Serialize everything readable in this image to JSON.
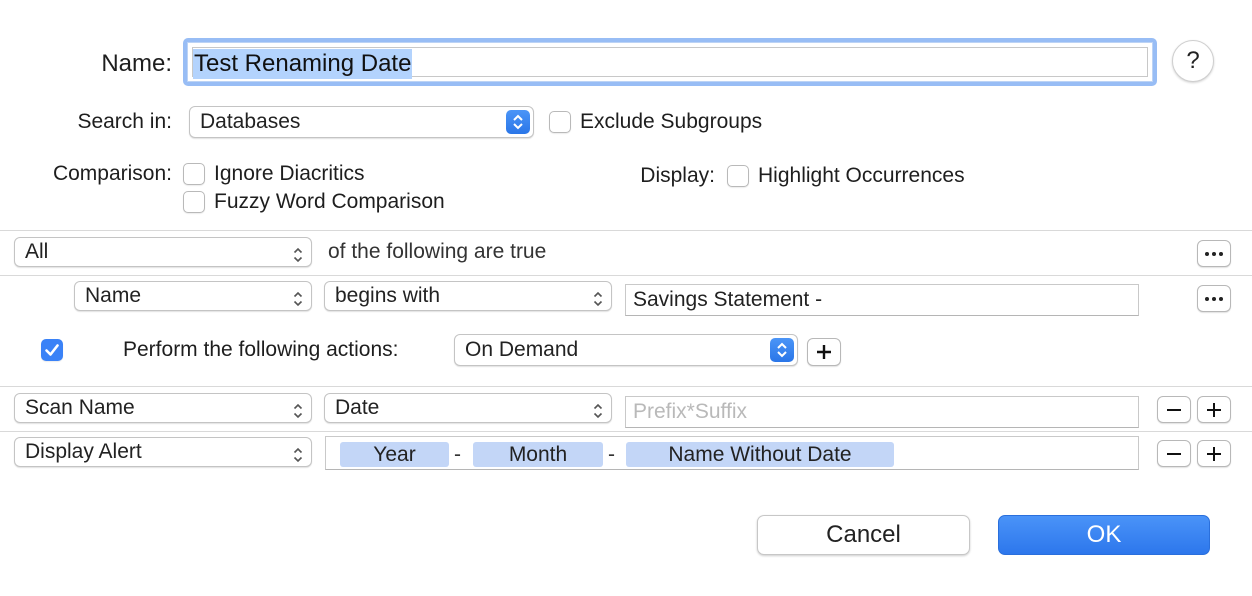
{
  "form": {
    "name_label": "Name:",
    "name_value": "Test Renaming Date",
    "help_symbol": "?",
    "search_in_label": "Search in:",
    "search_in_value": "Databases",
    "exclude_subgroups_label": "Exclude Subgroups",
    "comparison_label": "Comparison:",
    "ignore_diacritics_label": "Ignore Diacritics",
    "fuzzy_word_label": "Fuzzy Word Comparison",
    "display_label": "Display:",
    "highlight_label": "Highlight Occurrences"
  },
  "criteria": {
    "match_value": "All",
    "match_suffix": "of the following are true",
    "condition": {
      "field": "Name",
      "operator": "begins with",
      "value": "Savings Statement -"
    }
  },
  "actions": {
    "enabled_label": "Perform the following actions:",
    "trigger_value": "On Demand",
    "rows": [
      {
        "action": "Scan Name",
        "type": "Date",
        "placeholder": "Prefix*Suffix"
      },
      {
        "action": "Display Alert",
        "tokens": [
          "Year",
          "Month",
          "Name Without Date"
        ],
        "separator": "-"
      }
    ]
  },
  "buttons": {
    "cancel": "Cancel",
    "ok": "OK"
  },
  "colors": {
    "accent": "#3a82f7",
    "token_bg": "#c3d6f7",
    "selection": "#b3d3fd"
  }
}
